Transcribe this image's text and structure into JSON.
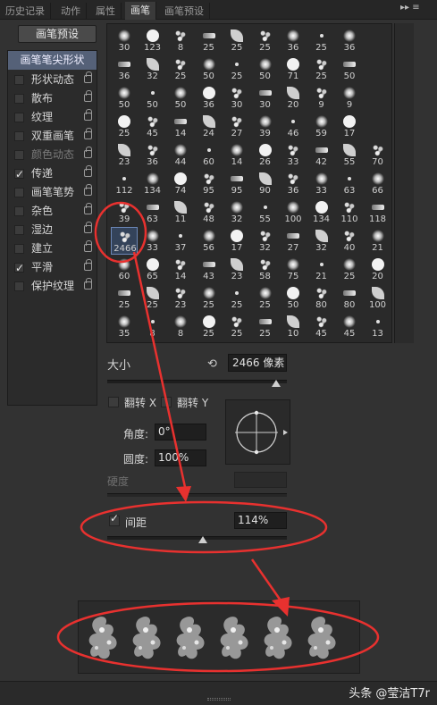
{
  "tabs": [
    "历史记录",
    "动作",
    "属性",
    "画笔",
    "画笔预设"
  ],
  "active_tab": "画笔",
  "panel_menu_glyph": "▸▸ ≡",
  "preset_button": "画笔预设",
  "left_list": {
    "header": "画笔笔尖形状",
    "items": [
      {
        "label": "形状动态",
        "checked": false,
        "dim": false
      },
      {
        "label": "散布",
        "checked": false,
        "dim": false
      },
      {
        "label": "纹理",
        "checked": false,
        "dim": false
      },
      {
        "label": "双重画笔",
        "checked": false,
        "dim": false
      },
      {
        "label": "颜色动态",
        "checked": false,
        "dim": true
      },
      {
        "label": "传递",
        "checked": true,
        "dim": false
      },
      {
        "label": "画笔笔势",
        "checked": false,
        "dim": false
      },
      {
        "label": "杂色",
        "checked": false,
        "dim": false
      },
      {
        "label": "湿边",
        "checked": false,
        "dim": false
      },
      {
        "label": "建立",
        "checked": false,
        "dim": false
      },
      {
        "label": "平滑",
        "checked": true,
        "dim": false
      },
      {
        "label": "保护纹理",
        "checked": false,
        "dim": false
      }
    ]
  },
  "brush_grid": {
    "rows": [
      [
        "30",
        "123",
        "8",
        "25",
        "25",
        "25",
        "36",
        "25",
        "36"
      ],
      [
        "36",
        "32",
        "25",
        "50",
        "25",
        "50",
        "71",
        "25",
        "50"
      ],
      [
        "50",
        "50",
        "50",
        "36",
        "30",
        "30",
        "20",
        "9",
        "9"
      ],
      [
        "25",
        "45",
        "14",
        "24",
        "27",
        "39",
        "46",
        "59",
        "17"
      ],
      [
        "23",
        "36",
        "44",
        "60",
        "14",
        "26",
        "33",
        "42",
        "55",
        "70"
      ],
      [
        "112",
        "134",
        "74",
        "95",
        "95",
        "90",
        "36",
        "33",
        "63",
        "66"
      ],
      [
        "39",
        "63",
        "11",
        "48",
        "32",
        "55",
        "100",
        "134",
        "110",
        "118"
      ],
      [
        "2466",
        "33",
        "37",
        "56",
        "17",
        "32",
        "27",
        "32",
        "40",
        "21"
      ],
      [
        "60",
        "65",
        "14",
        "43",
        "23",
        "58",
        "75",
        "21",
        "25",
        "20"
      ],
      [
        "25",
        "25",
        "23",
        "25",
        "25",
        "25",
        "50",
        "80",
        "80",
        "100"
      ],
      [
        "35",
        "8",
        "8",
        "25",
        "25",
        "25",
        "10",
        "45",
        "45",
        "13"
      ]
    ],
    "selected": "2466"
  },
  "size": {
    "label": "大小",
    "value": "2466 像素",
    "reset_icon": "⟲"
  },
  "flip": {
    "x_label": "翻转 X",
    "y_label": "翻转 Y"
  },
  "angle": {
    "label": "角度:",
    "value": "0°"
  },
  "roundness": {
    "label": "圆度:",
    "value": "100%"
  },
  "hardness": {
    "label": "硬度"
  },
  "spacing": {
    "label": "间距",
    "value": "114%",
    "checked": true
  },
  "watermark": "头条 @莹洁T7r",
  "colors": {
    "annotation": "#e8312f",
    "selected_bg": "#34435a",
    "header_bg": "#556178"
  }
}
